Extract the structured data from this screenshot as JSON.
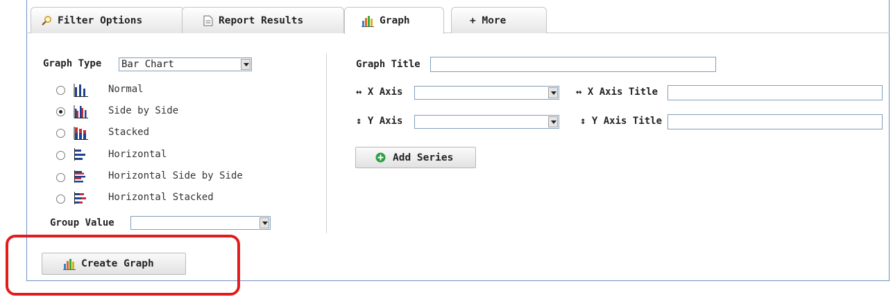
{
  "tabs": [
    {
      "label": "Filter Options",
      "icon": "magnifier-icon",
      "active": false
    },
    {
      "label": "Report Results",
      "icon": "document-icon",
      "active": false
    },
    {
      "label": "Graph",
      "icon": "bar-graph-icon",
      "active": true
    },
    {
      "label": "+ More",
      "icon": "",
      "active": false
    }
  ],
  "left": {
    "graph_type_label": "Graph Type",
    "graph_type_value": "Bar Chart",
    "options": [
      {
        "label": "Normal",
        "icon": "bar-chart-normal-icon",
        "selected": false
      },
      {
        "label": "Side by Side",
        "icon": "bar-chart-side-by-side-icon",
        "selected": true
      },
      {
        "label": "Stacked",
        "icon": "bar-chart-stacked-icon",
        "selected": false
      },
      {
        "label": "Horizontal",
        "icon": "bar-chart-horizontal-icon",
        "selected": false
      },
      {
        "label": "Horizontal Side by Side",
        "icon": "bar-chart-horizontal-side-by-side-icon",
        "selected": false
      },
      {
        "label": "Horizontal Stacked",
        "icon": "bar-chart-horizontal-stacked-icon",
        "selected": false
      }
    ],
    "group_value_label": "Group Value",
    "group_value_value": "",
    "create_button": "Create Graph"
  },
  "right": {
    "graph_title_label": "Graph Title",
    "x_axis_label": "↔ X Axis",
    "x_axis_title_label": "↔ X Axis Title",
    "y_axis_label": "↕ Y Axis",
    "y_axis_title_label": "↕ Y Axis Title",
    "add_series_button": "Add Series"
  },
  "colors": {
    "frame_border": "#6f8fbf",
    "highlight": "#e41b1b",
    "add_icon": "#2ea043"
  }
}
